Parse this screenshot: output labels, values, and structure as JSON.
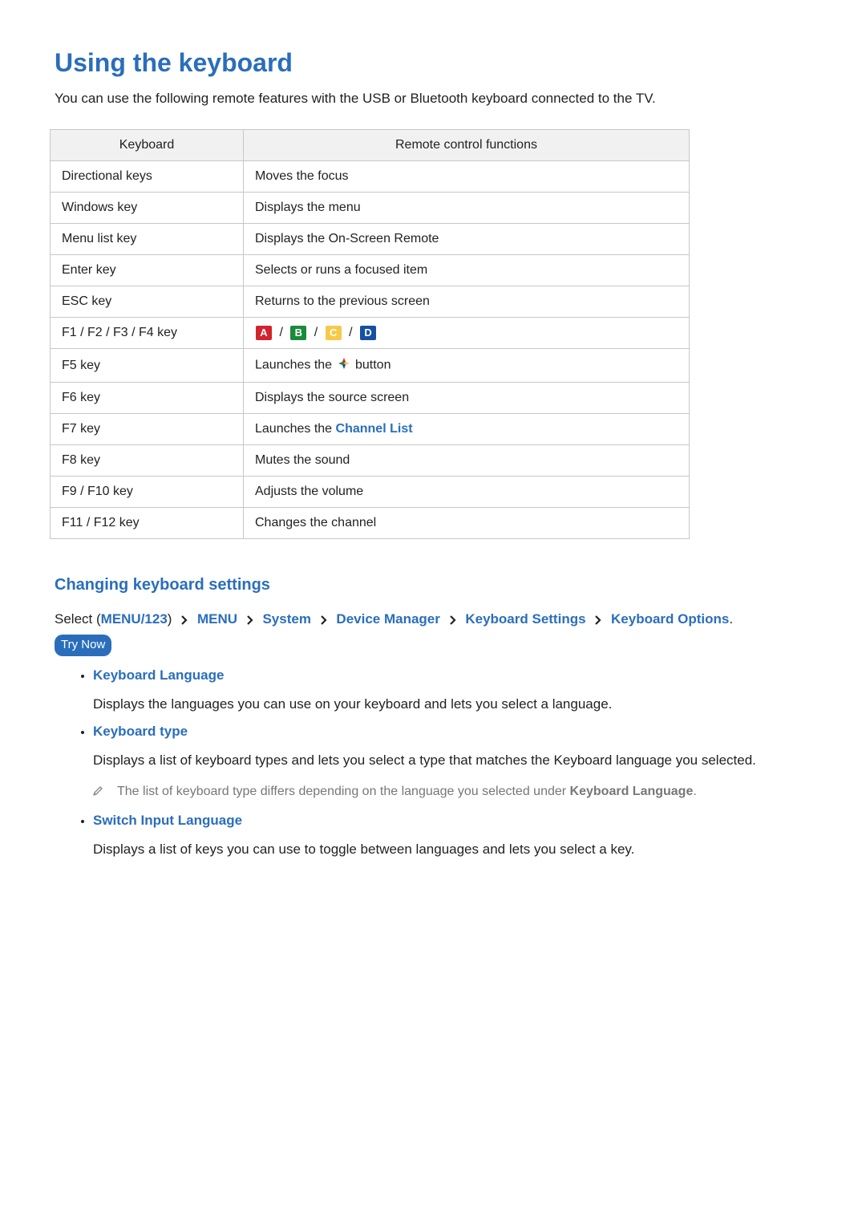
{
  "title": "Using the keyboard",
  "intro": "You can use the following remote features with the USB or Bluetooth keyboard connected to the TV.",
  "table": {
    "headers": {
      "key": "Keyboard",
      "func": "Remote control functions"
    },
    "rows": {
      "directional": {
        "key": "Directional keys",
        "func": "Moves the focus"
      },
      "windows": {
        "key": "Windows key",
        "func": "Displays the menu"
      },
      "menulist": {
        "key": "Menu list key",
        "func": "Displays the On-Screen Remote"
      },
      "enter": {
        "key": "Enter key",
        "func": "Selects or runs a focused item"
      },
      "esc": {
        "key": "ESC key",
        "func": "Returns to the previous screen"
      },
      "f1f4": {
        "key": "F1 / F2 / F3 / F4 key"
      },
      "f5": {
        "key": "F5 key",
        "func_prefix": "Launches the ",
        "func_suffix": " button"
      },
      "f6": {
        "key": "F6 key",
        "func": "Displays the source screen"
      },
      "f7": {
        "key": "F7 key",
        "func_prefix": "Launches the ",
        "func_link": "Channel List"
      },
      "f8": {
        "key": "F8 key",
        "func": "Mutes the sound"
      },
      "f9f10": {
        "key": "F9 / F10 key",
        "func": "Adjusts the volume"
      },
      "f11f12": {
        "key": "F11 / F12 key",
        "func": "Changes the channel"
      }
    },
    "color_buttons": {
      "a": "A",
      "b": "B",
      "c": "C",
      "d": "D",
      "sep": " / "
    }
  },
  "subheading": "Changing keyboard settings",
  "path": {
    "prefix": "Select ",
    "open": "(",
    "close": ")",
    "items": {
      "menu123": "MENU/123",
      "menu": "MENU",
      "system": "System",
      "device_manager": "Device Manager",
      "keyboard_settings": "Keyboard Settings",
      "keyboard_options": "Keyboard Options"
    },
    "period": "."
  },
  "try_now": "Try Now",
  "options": {
    "lang": {
      "title": "Keyboard Language",
      "desc": "Displays the languages you can use on your keyboard and lets you select a language."
    },
    "type": {
      "title": "Keyboard type",
      "desc": "Displays a list of keyboard types and lets you select a type that matches the Keyboard language you selected.",
      "note_prefix": "The list of keyboard type differs depending on the language you selected under ",
      "note_strong": "Keyboard Language",
      "note_suffix": "."
    },
    "switch": {
      "title": "Switch Input Language",
      "desc": "Displays a list of keys you can use to toggle between languages and lets you select a key."
    }
  }
}
